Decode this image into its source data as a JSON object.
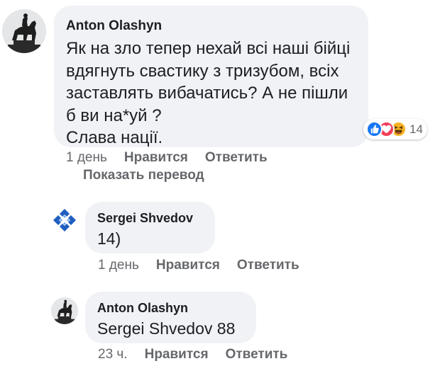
{
  "comments": [
    {
      "author": "Anton Olashyn",
      "avatar": "equestrian-statue-avatar",
      "lines": [
        "Як на зло тепер нехай всі наші бійці",
        "вдягнуть свастику з тризубом, всіх",
        "заставлять вибачатись? А не пішли",
        "б ви на*уй ?",
        "Слава нації."
      ],
      "time": "1 день",
      "like_label": "Нравится",
      "reply_label": "Ответить",
      "translate_label": "Показать перевод",
      "reactions": {
        "icons": [
          "like-icon",
          "love-icon",
          "haha-icon"
        ],
        "count": "14",
        "colors": {
          "like": "#1877f2",
          "love": "#f33e58",
          "haha": "#f7b125"
        }
      }
    },
    {
      "author": "Sergei Shvedov",
      "avatar": "blue-logo-avatar",
      "text": "14)",
      "time": "1 день",
      "like_label": "Нравится",
      "reply_label": "Ответить"
    },
    {
      "author": "Anton Olashyn",
      "avatar": "equestrian-statue-avatar",
      "text": "Sergei Shvedov 88",
      "time": "23 ч.",
      "like_label": "Нравится",
      "reply_label": "Ответить"
    }
  ],
  "colors": {
    "bubble": "#f0f2f5",
    "meta_text": "#65676b",
    "body_text": "#1c1e21"
  }
}
